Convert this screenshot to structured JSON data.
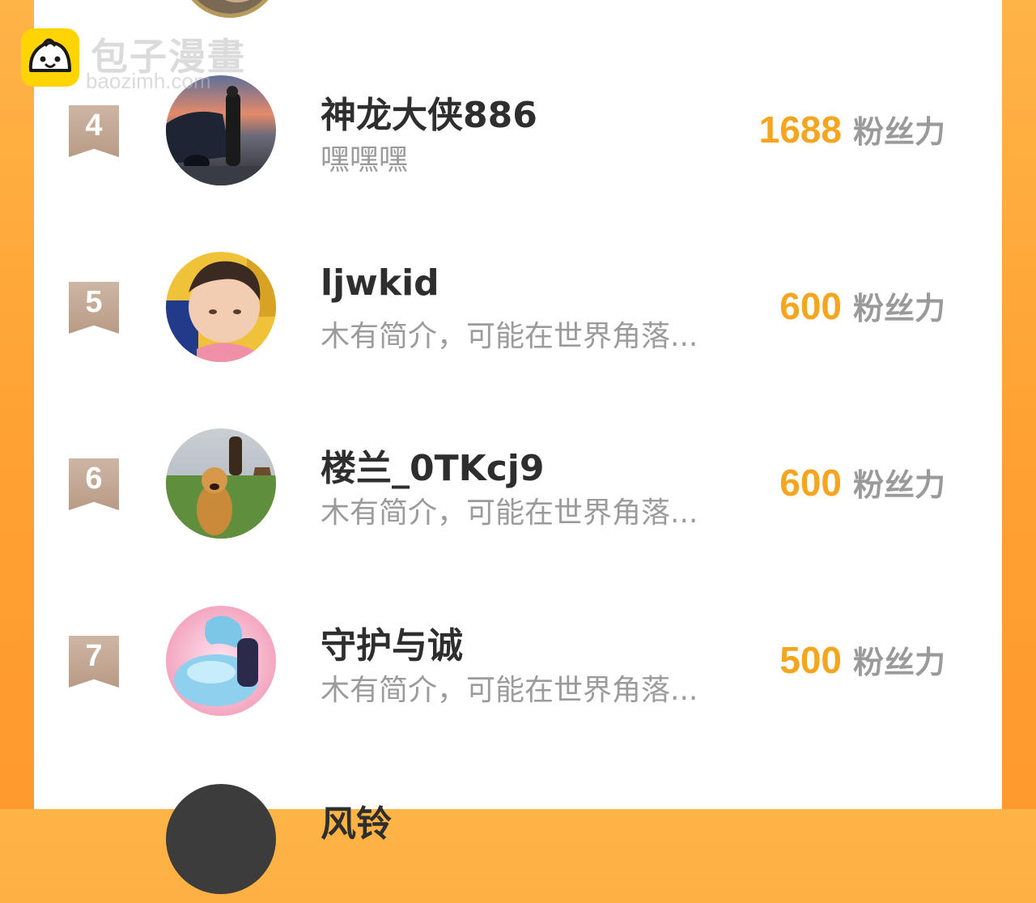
{
  "watermark": {
    "brand": "包子漫畫",
    "domain": "baozimh.com",
    "icon": "bun-face-icon"
  },
  "leaderboard": [
    {
      "rank": "4",
      "name": "神龙大侠886",
      "bio": "嘿嘿嘿",
      "fans": "1688",
      "unit": "粉丝力"
    },
    {
      "rank": "5",
      "name": "ljwkid",
      "bio": "木有简介，可能在世界角落...",
      "fans": "600",
      "unit": "粉丝力"
    },
    {
      "rank": "6",
      "name": "楼兰_0TKcj9",
      "bio": "木有简介，可能在世界角落...",
      "fans": "600",
      "unit": "粉丝力"
    },
    {
      "rank": "7",
      "name": "守护与诚",
      "bio": "木有简介，可能在世界角落...",
      "fans": "500",
      "unit": "粉丝力"
    },
    {
      "rank": "",
      "name": "风铃",
      "bio": "",
      "fans": "",
      "unit": ""
    }
  ],
  "colors": {
    "accent": "#f5a51f",
    "border_orange": "#ffa133",
    "rank_badge": "#c2a590",
    "name_text": "#2e2e2e",
    "muted_text": "#9b9b9b"
  }
}
